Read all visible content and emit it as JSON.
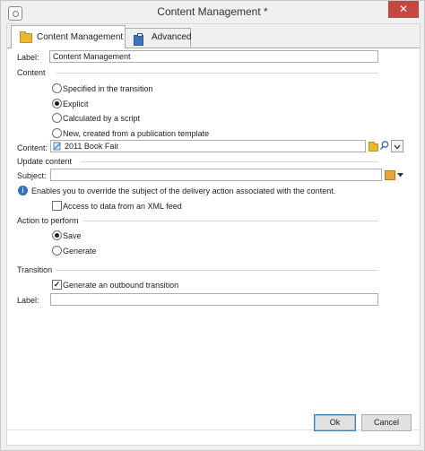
{
  "window": {
    "title": "Content Management *",
    "close_label": "✕"
  },
  "tabs": [
    {
      "label": "Content Management",
      "icon": "folder-icon"
    },
    {
      "label": "Advanced",
      "icon": "clipboard-icon"
    }
  ],
  "form": {
    "label_caption": "Label:",
    "label_value": "Content Management",
    "content_section": "Content",
    "content_options": [
      {
        "label": "Specified in the transition",
        "selected": false
      },
      {
        "label": "Explicit",
        "selected": true
      },
      {
        "label": "Calculated by a script",
        "selected": false
      },
      {
        "label": "New, created from a publication template",
        "selected": false
      }
    ],
    "content_caption": "Content:",
    "content_value": "2011 Book Fair",
    "update_section": "Update content",
    "subject_caption": "Subject:",
    "subject_value": "",
    "subject_info": "Enables you to override the subject of the delivery action associated with the content.",
    "xml_feed_label": "Access to data from an XML feed",
    "xml_feed_checked": false,
    "action_section": "Action to perform",
    "action_options": [
      {
        "label": "Save",
        "selected": true
      },
      {
        "label": "Generate",
        "selected": false
      }
    ],
    "transition_section": "Transition",
    "outbound_label": "Generate an outbound transition",
    "outbound_checked": true,
    "transition_label_caption": "Label:",
    "transition_label_value": ""
  },
  "buttons": {
    "ok": "Ok",
    "cancel": "Cancel"
  },
  "colors": {
    "close": "#c7463f",
    "accent": "#2e6fc2"
  }
}
